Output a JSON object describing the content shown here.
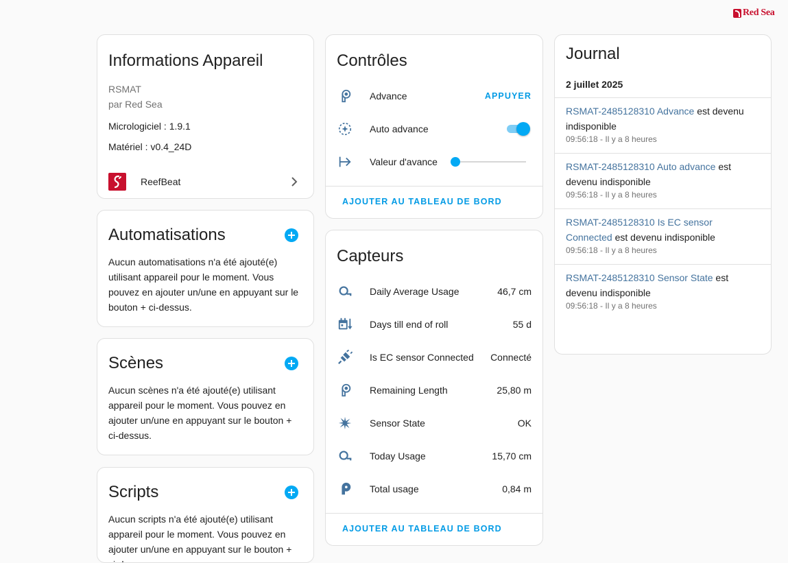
{
  "brand": {
    "name": "Red Sea"
  },
  "device_info": {
    "title": "Informations Appareil",
    "model": "RSMAT",
    "manufacturer": "par Red Sea",
    "firmware": "Micrologiciel : 1.9.1",
    "hardware": "Matériel : v0.4_24D",
    "integration": "ReefBeat"
  },
  "automations": {
    "title": "Automatisations",
    "text": "Aucun automatisations n'a été ajouté(e) utilisant appareil pour le moment. Vous pouvez en ajouter un/une en appuyant sur le bouton + ci-dessus."
  },
  "scenes": {
    "title": "Scènes",
    "text": "Aucun scènes n'a été ajouté(e) utilisant appareil pour le moment. Vous pouvez en ajouter un/une en appuyant sur le bouton + ci-dessus."
  },
  "scripts": {
    "title": "Scripts",
    "text": "Aucun scripts n'a été ajouté(e) utilisant appareil pour le moment. Vous pouvez en ajouter un/une en appuyant sur le bouton + ci-dessus."
  },
  "controls": {
    "title": "Contrôles",
    "advance_label": "Advance",
    "advance_action": "APPUYER",
    "auto_advance_label": "Auto advance",
    "auto_advance_on": true,
    "advance_value_label": "Valeur d'avance",
    "advance_value_fraction": 0.0,
    "add_to_dashboard": "AJOUTER AU TABLEAU DE BORD"
  },
  "sensors": {
    "title": "Capteurs",
    "items": [
      {
        "label": "Daily Average Usage",
        "value": "46,7 cm",
        "icon": "tape-measure-icon"
      },
      {
        "label": "Days till end of roll",
        "value": "55 d",
        "icon": "calendar-arrow-down-icon"
      },
      {
        "label": "Is EC sensor Connected",
        "value": "Connecté",
        "icon": "plug-connection-icon"
      },
      {
        "label": "Remaining Length",
        "value": "25,80 m",
        "icon": "paper-roll-icon"
      },
      {
        "label": "Sensor State",
        "value": "OK",
        "icon": "sensor-burst-icon"
      },
      {
        "label": "Today Usage",
        "value": "15,70 cm",
        "icon": "tape-measure-icon"
      },
      {
        "label": "Total usage",
        "value": "0,84 m",
        "icon": "paper-roll-filled-icon"
      }
    ],
    "add_to_dashboard": "AJOUTER AU TABLEAU DE BORD"
  },
  "logbook": {
    "title": "Journal",
    "date": "2 juillet 2025",
    "entries": [
      {
        "entity": "RSMAT-2485128310 Advance",
        "message": " est devenu indisponible",
        "time": "09:56:18 - Il y a 8 heures"
      },
      {
        "entity": "RSMAT-2485128310 Auto advance",
        "message": " est devenu indisponible",
        "time": "09:56:18 - Il y a 8 heures"
      },
      {
        "entity": "RSMAT-2485128310 Is EC sensor Connected",
        "message": " est devenu indisponible",
        "time": "09:56:18 - Il y a 8 heures"
      },
      {
        "entity": "RSMAT-2485128310 Sensor State",
        "message": " est devenu indisponible",
        "time": "09:56:18 - Il y a 8 heures"
      }
    ]
  },
  "colors": {
    "accent": "#03a9f4",
    "icon": "#44739e",
    "brand": "#c8102e"
  }
}
